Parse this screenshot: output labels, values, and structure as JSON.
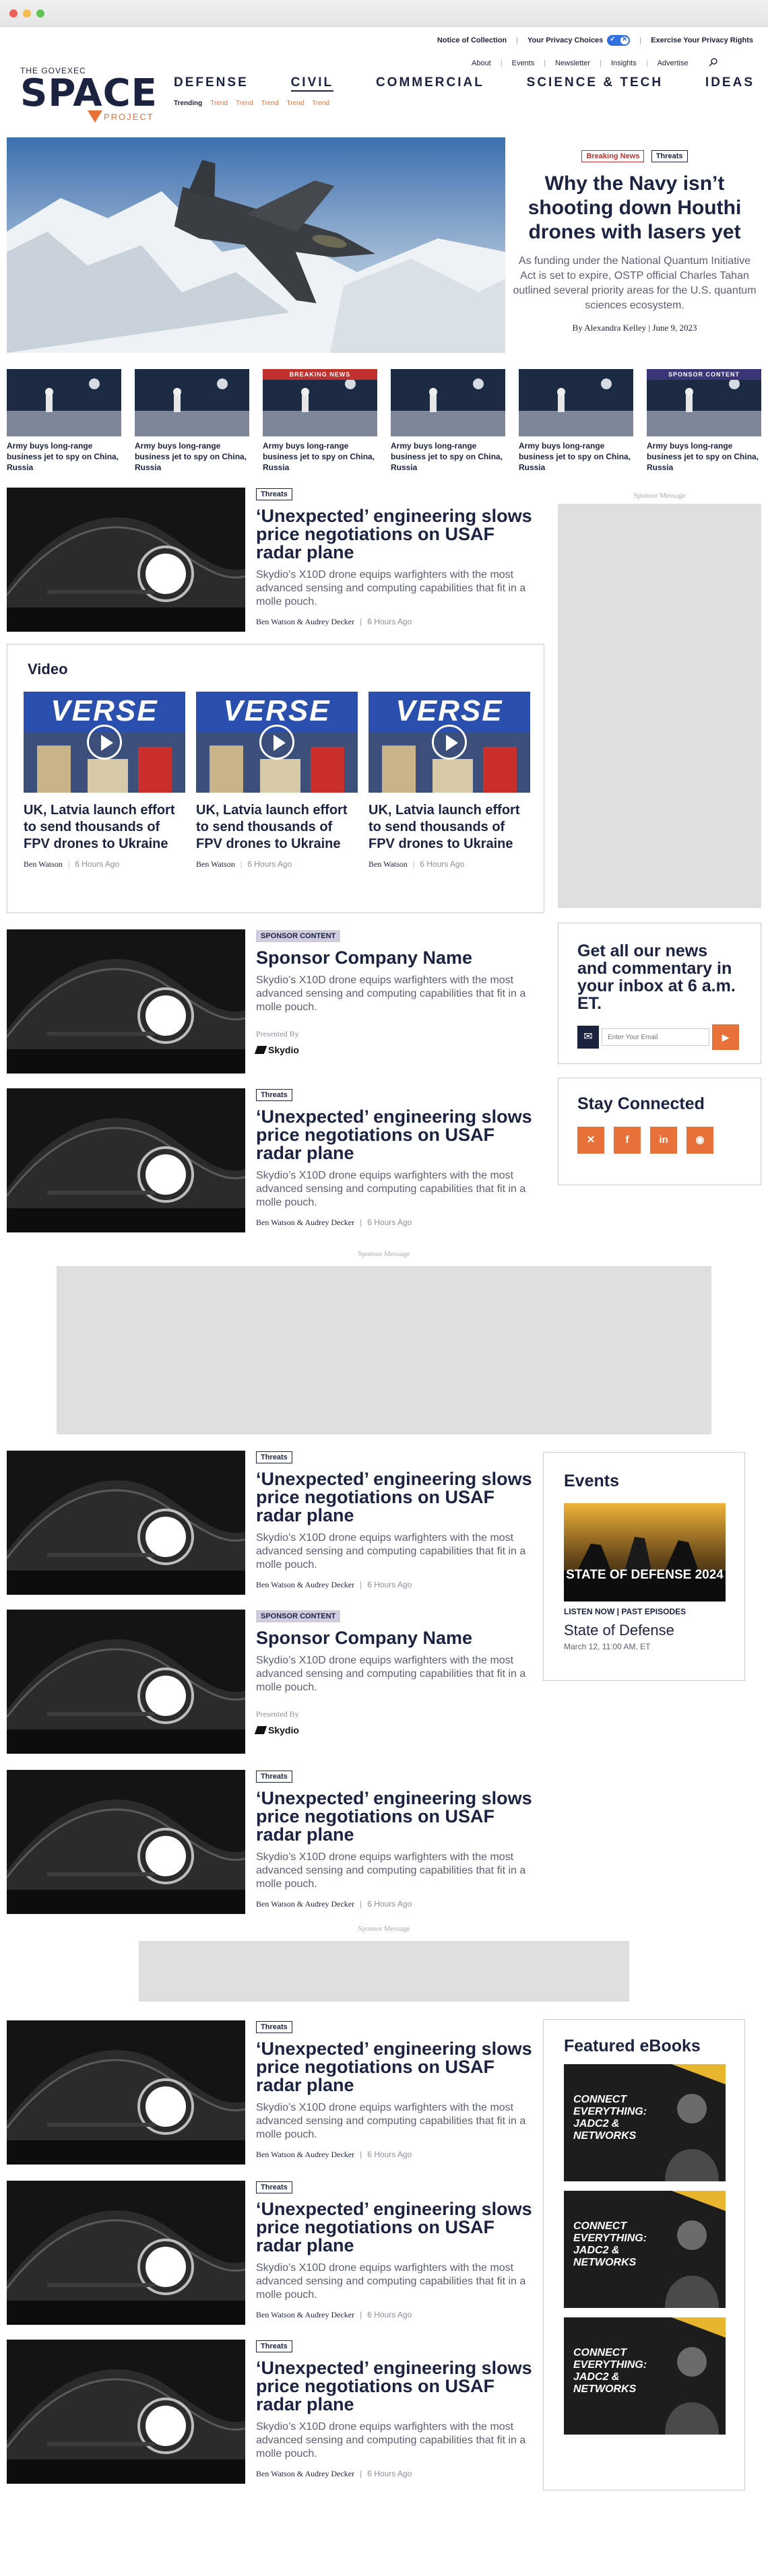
{
  "utility": {
    "notice": "Notice of Collection",
    "privacy_choices": "Your Privacy Choices",
    "exercise": "Exercise Your Privacy Rights"
  },
  "logo": {
    "top": "THE GOVEXEC",
    "main": "SPACE",
    "sub": "PROJECT"
  },
  "secondary_nav": [
    "About",
    "Events",
    "Newsletter",
    "Insights",
    "Advertise"
  ],
  "main_nav": [
    "DEFENSE",
    "CIVIL",
    "COMMERCIAL",
    "SCIENCE & TECH",
    "IDEAS"
  ],
  "trending": {
    "label": "Trending",
    "items": [
      "Trend",
      "Trend",
      "Trend",
      "Trend",
      "Trend"
    ]
  },
  "hero": {
    "tags": [
      "Breaking News",
      "Threats"
    ],
    "title": "Why the Navy isn’t shooting down Houthi drones with lasers yet",
    "dek": "As funding under the National Quantum Initiative Act is set to expire, OSTP official Charles Tahan outlined several priority areas for the U.S. quantum sciences ecosystem.",
    "byline": "By Alexandra Kelley | June 9, 2023"
  },
  "strip": [
    {
      "badge": "",
      "title": "Army buys long-range business jet to spy on China, Russia"
    },
    {
      "badge": "",
      "title": "Army buys long-range business jet to spy on China, Russia"
    },
    {
      "badge": "BREAKING NEWS",
      "badge_color": "#c0302c",
      "title": "Army buys long-range business jet to spy on China, Russia"
    },
    {
      "badge": "",
      "title": "Army buys long-range business jet to spy on China, Russia"
    },
    {
      "badge": "",
      "title": "Army buys long-range business jet to spy on China, Russia"
    },
    {
      "badge": "SPONSOR CONTENT",
      "badge_color": "#3a3578",
      "title": "Army buys long-range business jet to spy on China, Russia"
    }
  ],
  "article": {
    "tag": "Threats",
    "title": "‘Unexpected’ engineering slows price negotiations on USAF radar plane",
    "dek": "Skydio’s X10D drone equips warfighters with the most advanced sensing and computing capabilities that fit in a molle pouch.",
    "authors": "Ben Watson & Audrey Decker",
    "time": "6 Hours Ago"
  },
  "sponsor_article": {
    "tag": "SPONSOR CONTENT",
    "title": "Sponsor Company Name",
    "dek": "Skydio’s X10D drone equips warfighters with the most advanced sensing and computing capabilities that fit in a molle pouch.",
    "presented_by": "Presented By",
    "sponsor": "Skydio"
  },
  "video": {
    "heading": "Video",
    "overlay": "VERSE",
    "items": [
      {
        "title": "UK, Latvia launch effort to send thousands of FPV drones to Ukraine",
        "author": "Ben Watson",
        "time": "6 Hours Ago"
      },
      {
        "title": "UK, Latvia launch effort to send thousands of FPV drones to Ukraine",
        "author": "Ben Watson",
        "time": "6 Hours Ago"
      },
      {
        "title": "UK, Latvia launch effort to send thousands of FPV drones to Ukraine",
        "author": "Ben Watson",
        "time": "6 Hours Ago"
      }
    ]
  },
  "sponsor_label": "Sponsor Message",
  "newsletter": {
    "heading": "Get all our news and commentary in your inbox at 6 a.m. ET.",
    "placeholder": "Enter Your Email"
  },
  "stay": {
    "heading": "Stay Connected",
    "icons": [
      "x-icon",
      "facebook-icon",
      "linkedin-icon",
      "rss-icon"
    ]
  },
  "events": {
    "heading": "Events",
    "image_text": "STATE OF DEFENSE 2024",
    "links": "LISTEN NOW | PAST EPISODES",
    "title": "State of Defense",
    "date": "March 12, 11:00 AM, ET"
  },
  "ebooks": {
    "heading": "Featured eBooks",
    "title": "CONNECT EVERYTHING: JADC2 & NETWORKS"
  },
  "colors": {
    "navy": "#1c2340",
    "accent": "#e8713a",
    "breaking": "#c0302c",
    "sponsor": "#3a3578"
  }
}
